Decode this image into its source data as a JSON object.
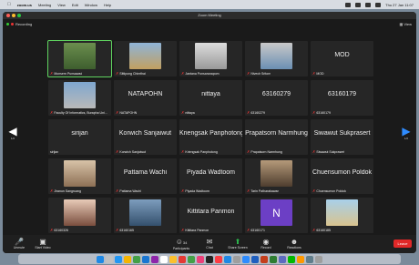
{
  "menubar": {
    "app": "zoom.us",
    "items": [
      "Meeting",
      "View",
      "Edit",
      "Window",
      "Help"
    ],
    "clock": "Thu 27 Jan 11:07"
  },
  "window": {
    "title": "Zoom Meeting",
    "recording": "Recording",
    "view_label": "View"
  },
  "pager": {
    "left": "1/2",
    "right": "1/2"
  },
  "tiles": [
    {
      "big": "",
      "label": "Monsern Punsawad",
      "muted": true,
      "pic": "person-man-video",
      "active": true
    },
    {
      "big": "",
      "label": "Sittipong Chimthai",
      "muted": true,
      "pic": "giraffe-photo"
    },
    {
      "big": "",
      "label": "Jantana Ponsaranapom",
      "muted": true,
      "pic": "person-woman-video"
    },
    {
      "big": "",
      "label": "Nivech Sritorn",
      "muted": true,
      "pic": "person-man-video-2"
    },
    {
      "big": "MOD",
      "label": "MOD",
      "muted": true,
      "pic": ""
    },
    {
      "big": "",
      "label": "Faculty Of Informatics, Burapha Uni...",
      "muted": true,
      "pic": "building-photo"
    },
    {
      "big": "NATAPOHN",
      "label": "NATAPOHN",
      "muted": true,
      "pic": ""
    },
    {
      "big": "nittaya",
      "label": "nittaya",
      "muted": true,
      "pic": ""
    },
    {
      "big": "63160279",
      "label": "63160279",
      "muted": true,
      "pic": ""
    },
    {
      "big": "63160179",
      "label": "63160179",
      "muted": true,
      "pic": ""
    },
    {
      "big": "sirijan",
      "label": "sirijan",
      "muted": false,
      "pic": ""
    },
    {
      "big": "Korwich Sanjaiwut",
      "label": "Korwich Sanjaiwut",
      "muted": true,
      "pic": ""
    },
    {
      "big": "Kriengsak Panphotong",
      "label": "Kriengsak Panphotong",
      "muted": true,
      "pic": ""
    },
    {
      "big": "Prapatsorn Narmhung",
      "label": "Prapatsorn Narmhung",
      "muted": true,
      "pic": ""
    },
    {
      "big": "Siwawut Sukprasert",
      "label": "Siwawut Sukprasert",
      "muted": true,
      "pic": ""
    },
    {
      "big": "",
      "label": "Jiranun  Sangruang",
      "muted": true,
      "pic": "cat-photo"
    },
    {
      "big": "Pattama Wachi",
      "label": "Pattama Wachi",
      "muted": true,
      "pic": ""
    },
    {
      "big": "Piyada Wadtoom",
      "label": "Piyada Wadtoom",
      "muted": true,
      "pic": ""
    },
    {
      "big": "",
      "label": "Tarin Patharakawan",
      "muted": true,
      "pic": "person-photo"
    },
    {
      "big": "Chuensumon Poldok",
      "label": "Chuensumon Poldok",
      "muted": true,
      "pic": ""
    },
    {
      "big": "",
      "label": "63160326",
      "muted": true,
      "pic": "woman-photo"
    },
    {
      "big": "",
      "label": "63160165",
      "muted": true,
      "pic": "scenery-photo"
    },
    {
      "big": "Kittitara Panmon",
      "label": "Kittitara Panmon",
      "muted": true,
      "pic": ""
    },
    {
      "big": "",
      "label": "63160171",
      "muted": true,
      "pic": "avatar-letter",
      "letter": "N"
    },
    {
      "big": "",
      "label": "63160185",
      "muted": true,
      "pic": "beach-photo"
    }
  ],
  "toolbar": {
    "unmute": "Unmute",
    "start_video": "Start Video",
    "participants": "Participants",
    "participants_count": "34",
    "chat": "Chat",
    "share_screen": "Share Screen",
    "record": "Record",
    "reactions": "Reactions",
    "leave": "Leave"
  },
  "colors": {
    "accent_green": "#5fd35f",
    "leave_red": "#e02828",
    "share_green": "#2dbb4e"
  }
}
